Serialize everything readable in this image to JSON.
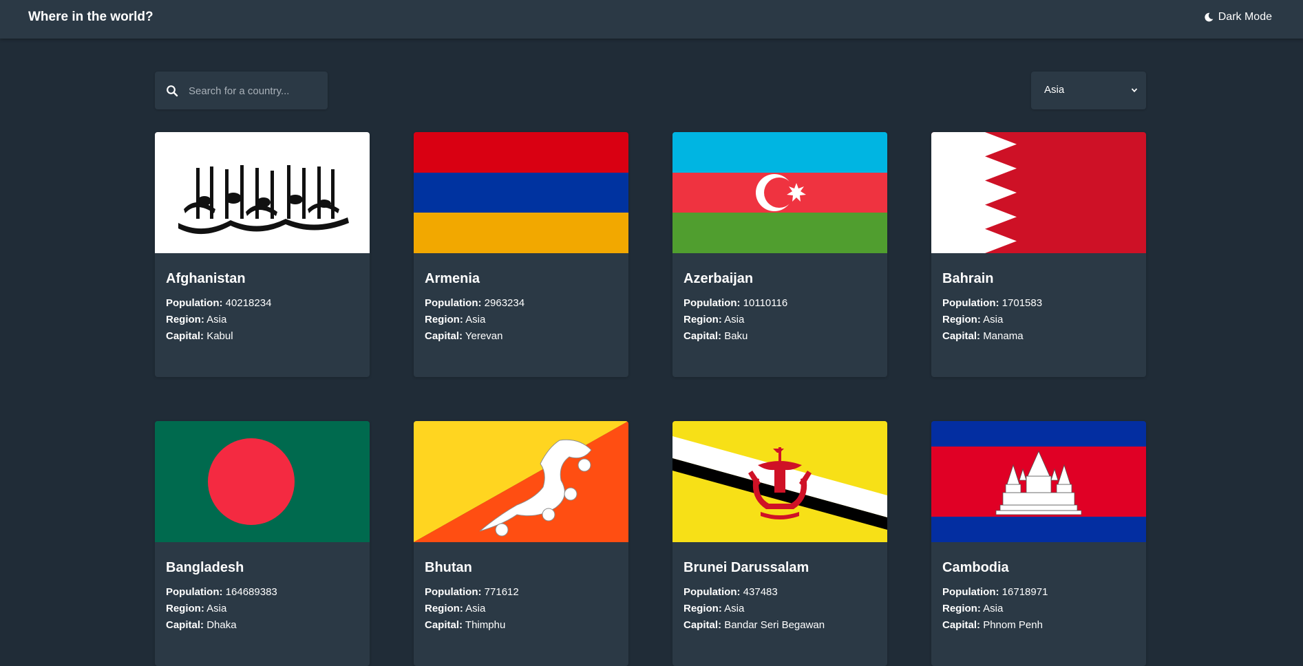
{
  "header": {
    "title": "Where in the world?",
    "mode_label": "Dark Mode"
  },
  "search": {
    "placeholder": "Search for a country..."
  },
  "filter": {
    "selected": "Asia"
  },
  "labels": {
    "population": "Population:",
    "region": "Region:",
    "capital": "Capital:"
  },
  "countries": [
    {
      "name": "Afghanistan",
      "population": "40218234",
      "region": "Asia",
      "capital": "Kabul"
    },
    {
      "name": "Armenia",
      "population": "2963234",
      "region": "Asia",
      "capital": "Yerevan"
    },
    {
      "name": "Azerbaijan",
      "population": "10110116",
      "region": "Asia",
      "capital": "Baku"
    },
    {
      "name": "Bahrain",
      "population": "1701583",
      "region": "Asia",
      "capital": "Manama"
    },
    {
      "name": "Bangladesh",
      "population": "164689383",
      "region": "Asia",
      "capital": "Dhaka"
    },
    {
      "name": "Bhutan",
      "population": "771612",
      "region": "Asia",
      "capital": "Thimphu"
    },
    {
      "name": "Brunei Darussalam",
      "population": "437483",
      "region": "Asia",
      "capital": "Bandar Seri Begawan"
    },
    {
      "name": "Cambodia",
      "population": "16718971",
      "region": "Asia",
      "capital": "Phnom Penh"
    }
  ]
}
